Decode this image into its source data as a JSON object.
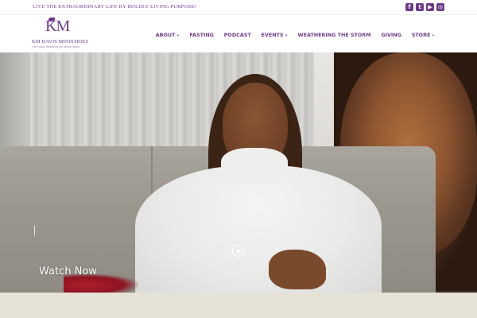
{
  "topbar": {
    "tagline": "LIVE THE EXTRAORDINARY LIFE BY BOLDLY LIVING PURPOSE!",
    "social": [
      {
        "icon": "facebook-icon",
        "glyph": "f"
      },
      {
        "icon": "twitter-icon",
        "glyph": "t"
      },
      {
        "icon": "youtube-icon",
        "glyph": "▶"
      },
      {
        "icon": "instagram-icon",
        "glyph": "◎"
      }
    ]
  },
  "header": {
    "logo_mark": "KM",
    "logo_name": "KM DAVIS MINISTRIES",
    "logo_sub": "One Voice Reaching the Whole World"
  },
  "nav": {
    "items": [
      {
        "label": "ABOUT",
        "dropdown": true
      },
      {
        "label": "FASTING",
        "dropdown": false
      },
      {
        "label": "PODCAST",
        "dropdown": false
      },
      {
        "label": "EVENTS",
        "dropdown": true
      },
      {
        "label": "WEATHERING THE STORM",
        "dropdown": false
      },
      {
        "label": "GIVING",
        "dropdown": false
      },
      {
        "label": "STORE",
        "dropdown": true
      }
    ]
  },
  "hero": {
    "cta": "Watch Now"
  },
  "colors": {
    "brand": "#6e3b87",
    "floor": "#e6e2d6"
  }
}
